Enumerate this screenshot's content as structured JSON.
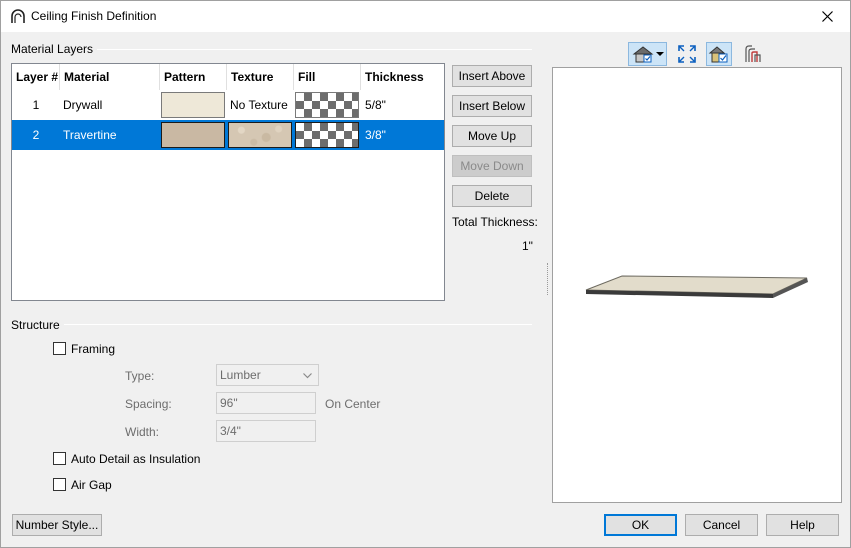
{
  "window": {
    "title": "Ceiling Finish Definition"
  },
  "material_layers": {
    "group_label": "Material Layers",
    "columns": [
      "Layer #",
      "Material",
      "Pattern",
      "Texture",
      "Fill",
      "Thickness"
    ],
    "rows": [
      {
        "layer": "1",
        "material": "Drywall",
        "texture": "No Texture",
        "thickness": "5/8\"",
        "pattern_color": "#eee8d8",
        "selected": false
      },
      {
        "layer": "2",
        "material": "Travertine",
        "texture": "",
        "thickness": "3/8\"",
        "pattern_color": "#c9b8a3",
        "selected": true
      }
    ]
  },
  "side_buttons": {
    "insert_above": "Insert Above",
    "insert_below": "Insert Below",
    "move_up": "Move Up",
    "move_down": "Move Down",
    "delete": "Delete"
  },
  "total_thickness": {
    "label": "Total Thickness:",
    "value": "1\""
  },
  "structure": {
    "group_label": "Structure",
    "framing_label": "Framing",
    "type_label": "Type:",
    "type_value": "Lumber",
    "spacing_label": "Spacing:",
    "spacing_value": "96\"",
    "on_center_label": "On Center",
    "width_label": "Width:",
    "width_value": "3/4\"",
    "auto_detail_label": "Auto Detail as Insulation",
    "air_gap_label": "Air Gap"
  },
  "footer": {
    "number_style": "Number Style...",
    "ok": "OK",
    "cancel": "Cancel",
    "help": "Help"
  },
  "preview_tools": [
    "camera-view-icon",
    "fit-view-icon",
    "render-mode-icon",
    "layers-icon"
  ],
  "colors": {
    "selection": "#0078d7",
    "slab_top": "#e2dccb",
    "slab_edge": "#3a3a3a"
  }
}
